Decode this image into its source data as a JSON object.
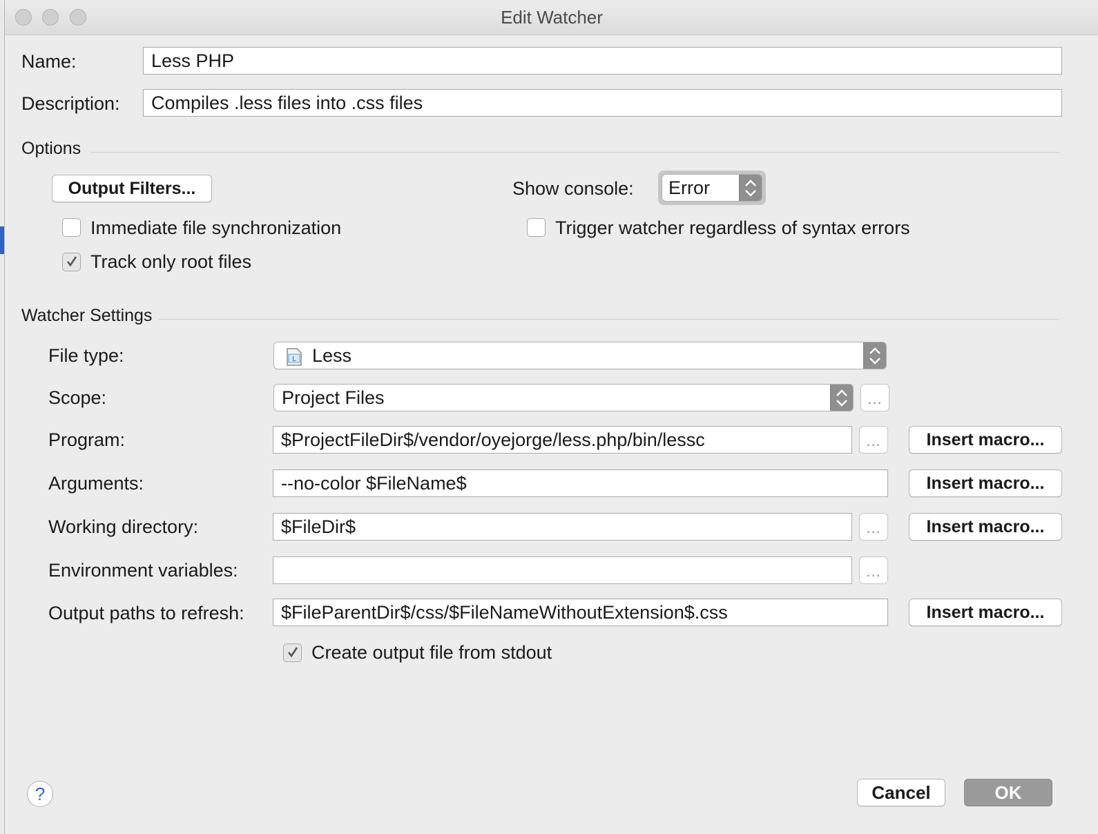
{
  "window": {
    "title": "Edit Watcher"
  },
  "name": {
    "label": "Name:",
    "value": "Less PHP"
  },
  "description": {
    "label": "Description:",
    "value": "Compiles .less files into .css files"
  },
  "options": {
    "section_title": "Options",
    "output_filters_label": "Output Filters...",
    "show_console_label": "Show console:",
    "show_console_value": "Error",
    "immediate_sync": {
      "label": "Immediate file synchronization",
      "checked": false
    },
    "trigger_regardless": {
      "label": "Trigger watcher regardless of syntax errors",
      "checked": false
    },
    "track_root": {
      "label": "Track only root files",
      "checked": true
    }
  },
  "watcher_settings": {
    "section_title": "Watcher Settings",
    "file_type": {
      "label": "File type:",
      "value": "Less",
      "icon": "less-file-icon"
    },
    "scope": {
      "label": "Scope:",
      "value": "Project Files"
    },
    "program": {
      "label": "Program:",
      "value": "$ProjectFileDir$/vendor/oyejorge/less.php/bin/lessc"
    },
    "arguments": {
      "label": "Arguments:",
      "value": "--no-color $FileName$"
    },
    "working_directory": {
      "label": "Working directory:",
      "value": "$FileDir$"
    },
    "environment_variables": {
      "label": "Environment variables:",
      "value": ""
    },
    "output_paths": {
      "label": "Output paths to refresh:",
      "value": "$FileParentDir$/css/$FileNameWithoutExtension$.css"
    },
    "create_output": {
      "label": "Create output file from stdout",
      "checked": true
    },
    "insert_macro_label": "Insert macro...",
    "ellipsis_label": "..."
  },
  "footer": {
    "help_label": "?",
    "cancel_label": "Cancel",
    "ok_label": "OK"
  },
  "colors": {
    "accent": "#2a64c8",
    "ok_disabled": "#9a9a9a",
    "stepper": "#8f8f8f"
  }
}
